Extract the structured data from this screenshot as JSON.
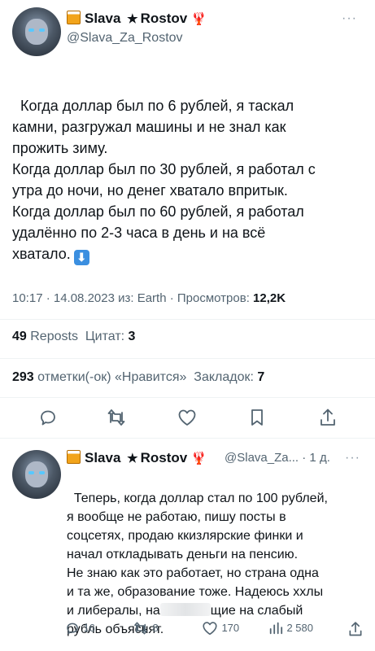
{
  "tweet": {
    "display_name_first": "Slava",
    "display_name_second": "Rostov",
    "handle": "@Slava_Za_Rostov",
    "more": "···",
    "body": "Когда доллар был по 6 рублей, я таскал\nкамни, разгружал машины и не знал как\nпрожить зиму.\nКогда доллар был по 30 рублей, я работал с\nутра до ночи, но денег хватало впритык.\nКогда доллар был по 60 рублей, я работал\nудалённо по 2-3 часа в день и на всё\nхватало.",
    "emoji": "⬇",
    "time_date": "10:17 · 14.08.2023 из: Earth · Просмотров: ",
    "views": "12,2K"
  },
  "stats": {
    "reposts_count": "49",
    "reposts_label": "Reposts",
    "quotes_label": "Цитат:",
    "quotes_count": "3",
    "likes_count": "293",
    "likes_label": "отметки(-ок) «Нравится»",
    "bookmarks_label": "Закладок:",
    "bookmarks_count": "7"
  },
  "actions": [
    "reply-icon",
    "repost-icon",
    "like-icon",
    "bookmark-icon",
    "share-icon"
  ],
  "reply": {
    "display_name_first": "Slava",
    "display_name_second": "Rostov",
    "handle_time": "@Slava_Za... · 1 д.",
    "more": "···",
    "body_before": "Теперь, когда доллар стал по 100 рублей,\nя вообще не работаю, пишу посты в\nсоцсетях, продаю ккизлярские финки и\nначал откладывать деньги на пенсию.\nНе знаю как это работает, но страна одна\nи та же, образование тоже. Надеюсь ххлы\nи либералы, на",
    "body_after": "щие на слабый\nрубль объяснят.",
    "counts": {
      "replies": "16",
      "reposts": "8",
      "likes": "170",
      "views": "2 580"
    }
  },
  "colors": {
    "text": "#0f1419",
    "secondary": "#536471",
    "divider": "#eff3f4",
    "emoji_blue": "#3b8fe0"
  }
}
